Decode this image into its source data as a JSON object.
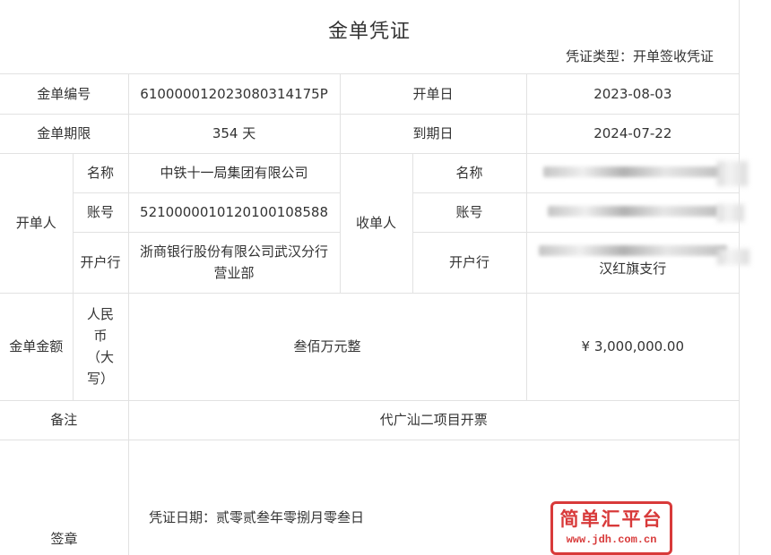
{
  "header": {
    "title": "金单凭证",
    "type_label": "凭证类型：",
    "type_value": "开单签收凭证"
  },
  "row_number": {
    "label": "金单编号",
    "value": "61000001202308031 4175P",
    "issue_date_label": "开单日",
    "issue_date_value": "2023-08-03"
  },
  "row_term": {
    "label": "金单期限",
    "value": "354 天",
    "due_date_label": "到期日",
    "due_date_value": "2024-07-22"
  },
  "issuer": {
    "label": "开单人",
    "name_label": "名称",
    "name_value": "中铁十一局集团有限公司",
    "account_label": "账号",
    "account_value": "521000001012010010 8588",
    "bank_label": "开户行",
    "bank_value": "浙商银行股份有限公司武汉分行营业部"
  },
  "receiver": {
    "label": "收单人",
    "name_label": "名称",
    "account_label": "账号",
    "bank_label": "开户行",
    "bank_value_tail": "汉红旗支行"
  },
  "amount": {
    "label": "金单金额",
    "currency_label": "人民币（大写）",
    "value_upper": "叁佰万元整",
    "value_number": "¥ 3,000,000.00"
  },
  "remark": {
    "label": "备注",
    "value": "代广汕二项目开票"
  },
  "signature": {
    "label": "签章",
    "date_text": "凭证日期：贰零贰叁年零捌月零叁日",
    "seal_main": "简单汇平台",
    "seal_url": "www.jdh.com.cn"
  }
}
